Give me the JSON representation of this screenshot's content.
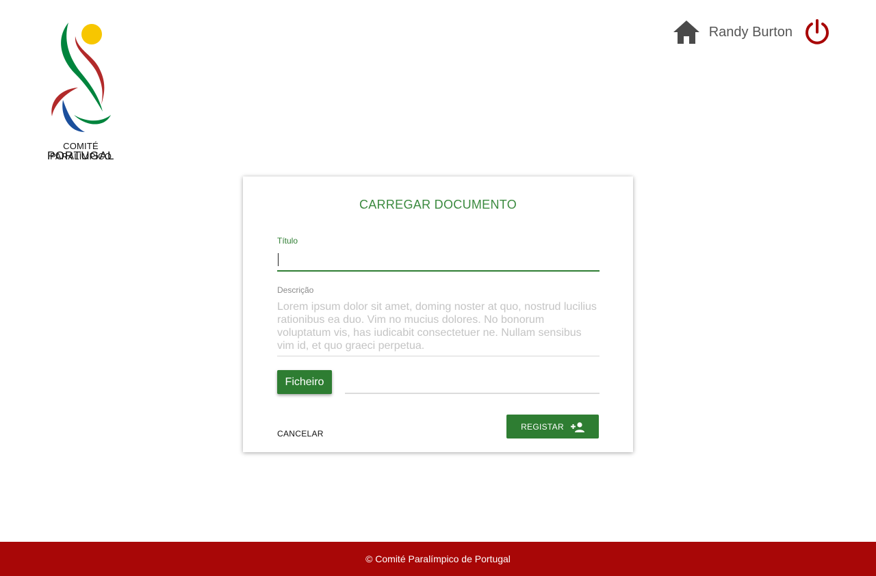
{
  "brand": {
    "logo_line1": "COMITÉ PARALÍMPICO",
    "logo_line2": "PORTUGAL",
    "colors": {
      "green": "#2e7d32",
      "red": "#a80707",
      "yellow": "#f7c600",
      "blue": "#1b4f9c"
    }
  },
  "header": {
    "home_icon": "home-icon",
    "user_name": "Randy Burton",
    "logout_icon": "power-icon"
  },
  "form": {
    "title": "CARREGAR DOCUMENTO",
    "titulo_label": "Título",
    "titulo_value": "",
    "descricao_label": "Descrição",
    "descricao_value": "",
    "descricao_placeholder": "Lorem ipsum dolor sit amet, doming noster at quo, nostrud lucilius rationibus ea duo. Vim no mucius dolores. No bonorum voluptatum vis, has iudicabit consectetuer ne. Nullam sensibus vim id, et quo graeci perpetua.",
    "file_button_label": "Ficheiro",
    "cancel_label": "CANCELAR",
    "register_label": "REGISTAR",
    "register_icon": "add-person-icon"
  },
  "footer": {
    "text": "© Comité Paralímpico de Portugal"
  }
}
